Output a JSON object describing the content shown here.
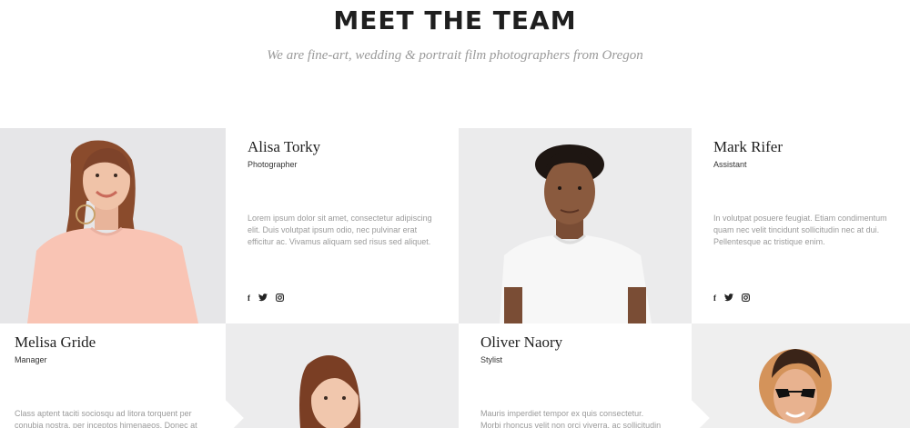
{
  "header": {
    "title": "MEET THE TEAM",
    "subtitle": "We are fine-art, wedding & portrait film photographers from Oregon"
  },
  "team": [
    {
      "name": "Alisa Torky",
      "role": "Photographer",
      "bio": "Lorem ipsum dolor sit amet, consectetur adipiscing elit. Duis volutpat ipsum odio, nec pulvinar erat efficitur ac. Vivamus aliquam sed risus sed aliquet.",
      "social": {
        "facebook": "f",
        "twitter": "t",
        "instagram": "o"
      }
    },
    {
      "name": "Mark Rifer",
      "role": "Assistant",
      "bio": "In volutpat posuere feugiat. Etiam condimentum quam nec velit tincidunt sollicitudin nec at dui. Pellentesque ac tristique enim.",
      "social": {
        "facebook": "f",
        "twitter": "t",
        "instagram": "o"
      }
    },
    {
      "name": "Melisa Gride",
      "role": "Manager",
      "bio": "Class aptent taciti sociosqu ad litora torquent per conubia nostra, per inceptos himenaeos. Donec at"
    },
    {
      "name": "Oliver Naory",
      "role": "Stylist",
      "bio": "Mauris imperdiet tempor ex quis consectetur. Morbi rhoncus velit non orci viverra, ac sollicitudin orci"
    }
  ],
  "colors": {
    "text_dark": "#222222",
    "text_muted": "#9a9a9a",
    "photo_bg": "#e8e8e8"
  }
}
